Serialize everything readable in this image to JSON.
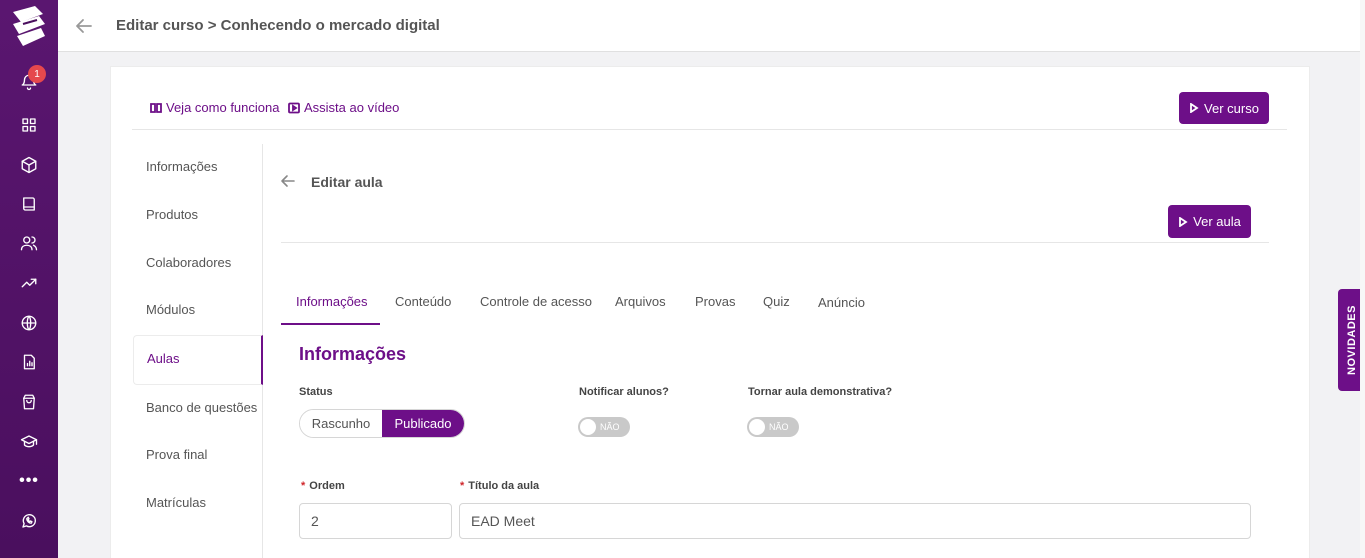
{
  "sidebar": {
    "notification_count": "1",
    "more_label": "•••"
  },
  "header": {
    "title": "Editar curso > Conhecendo o mercado digital"
  },
  "help": {
    "how_it_works": "Veja como funciona",
    "watch_video": "Assista ao vídeo",
    "view_course": "Ver curso"
  },
  "subnav": {
    "items": [
      "Informações",
      "Produtos",
      "Colaboradores",
      "Módulos",
      "Aulas",
      "Banco de questões",
      "Prova final",
      "Matrículas"
    ]
  },
  "lesson": {
    "title": "Editar aula",
    "view_lesson": "Ver aula"
  },
  "tabs": [
    "Informações",
    "Conteúdo",
    "Controle de acesso",
    "Arquivos",
    "Provas",
    "Quiz",
    "Anúncio"
  ],
  "form": {
    "section_title": "Informações",
    "status_label": "Status",
    "status_options": [
      "Rascunho",
      "Publicado"
    ],
    "notify_label": "Notificar alunos?",
    "notify_value": "NÃO",
    "demo_label": "Tornar aula demonstrativa?",
    "demo_value": "NÃO",
    "order_label": "Ordem",
    "order_value": "2",
    "title_label": "Título da aula",
    "title_value": "EAD Meet",
    "required_mark": "*"
  },
  "novidades": "NOVIDADES",
  "colors": {
    "brand": "#6d0f88",
    "sidebar": "#4a0f5e"
  }
}
